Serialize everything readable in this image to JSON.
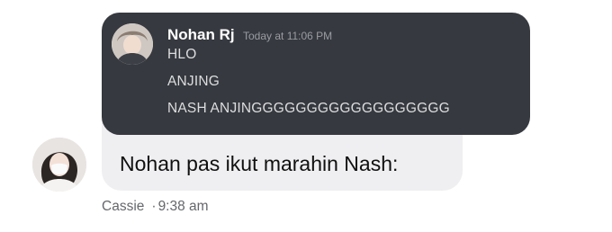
{
  "embedded_message": {
    "author": "Nohan Rj",
    "timestamp": "Today at 11:06 PM",
    "lines": [
      "HLO",
      "ANJING",
      "NASH ANJINGGGGGGGGGGGGGGGGGG"
    ]
  },
  "chat_message": {
    "text": "Nohan pas ikut marahin Nash:",
    "sender": "Cassie",
    "separator": "·",
    "time": "9:38 am"
  },
  "colors": {
    "dark_card": "#36393f",
    "bubble": "#efeff1",
    "meta_text": "#65676b"
  },
  "icons": {
    "embedded_avatar": "avatar-icon",
    "sender_avatar": "avatar-icon"
  }
}
